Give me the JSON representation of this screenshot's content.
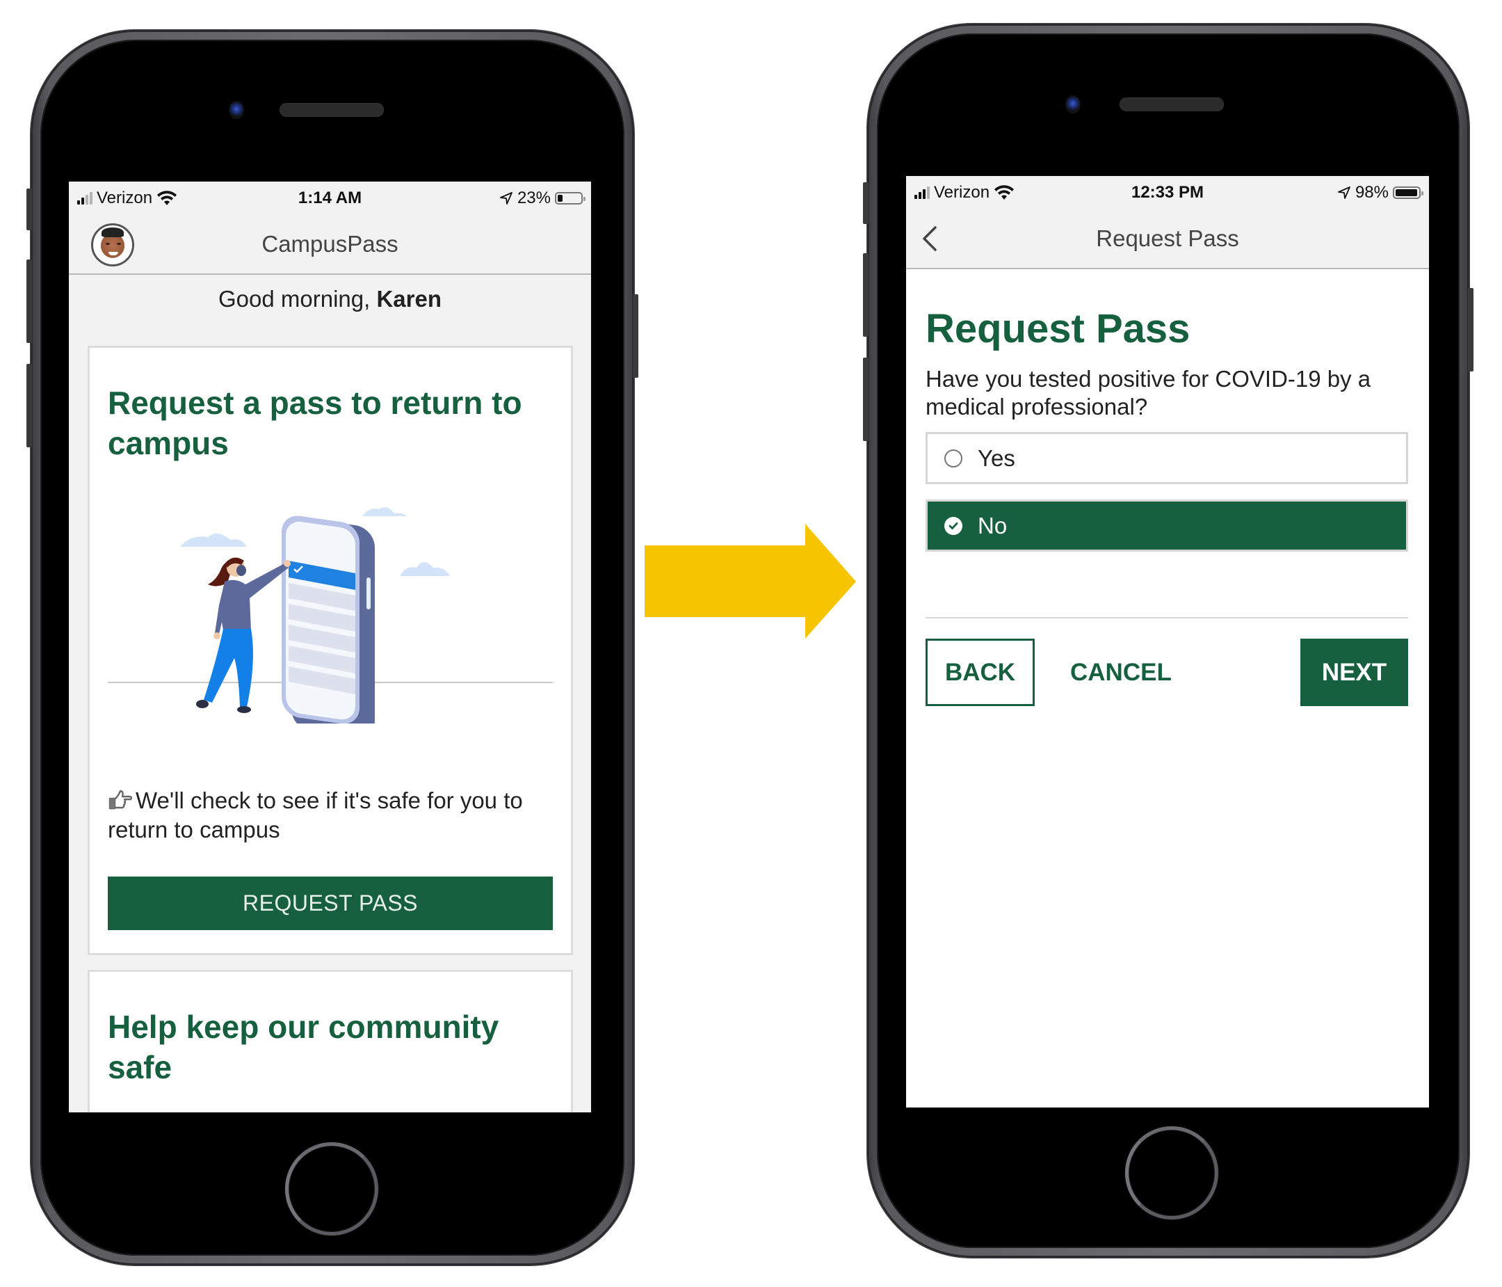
{
  "colors": {
    "brand_green": "#17603f",
    "arrow_yellow": "#f7c400",
    "header_bg": "#f2f2f2"
  },
  "left_phone": {
    "status_bar": {
      "carrier": "Verizon",
      "time": "1:14 AM",
      "battery_percent_label": "23%",
      "battery_level": 0.23,
      "icons": [
        "signal-icon",
        "wifi-icon",
        "location-arrow-icon",
        "battery-icon"
      ]
    },
    "header": {
      "title": "CampusPass",
      "avatar": "user-avatar"
    },
    "greeting": {
      "prefix": "Good morning, ",
      "name": "Karen"
    },
    "cards": [
      {
        "title": "Request a pass to return to campus",
        "illustration": "woman-with-mask-tapping-phone-illustration",
        "info_icon": "thumbs-up-outline-icon",
        "info_text": "We'll check to see if it's safe for you to return to campus",
        "button_label": "REQUEST PASS"
      },
      {
        "title": "Help keep our community safe"
      }
    ]
  },
  "transition_arrow": {
    "icon": "right-arrow-icon"
  },
  "right_phone": {
    "status_bar": {
      "carrier": "Verizon",
      "time": "12:33 PM",
      "battery_percent_label": "98%",
      "battery_level": 0.98,
      "icons": [
        "signal-icon",
        "wifi-icon",
        "location-arrow-icon",
        "battery-icon"
      ]
    },
    "header": {
      "title": "Request Pass",
      "back_icon": "chevron-left-icon"
    },
    "form": {
      "heading": "Request Pass",
      "question": "Have you tested positive for COVID-19 by a medical professional?",
      "options": [
        {
          "label": "Yes",
          "selected": false
        },
        {
          "label": "No",
          "selected": true
        }
      ]
    },
    "actions": {
      "back_label": "BACK",
      "cancel_label": "CANCEL",
      "next_label": "NEXT"
    }
  }
}
